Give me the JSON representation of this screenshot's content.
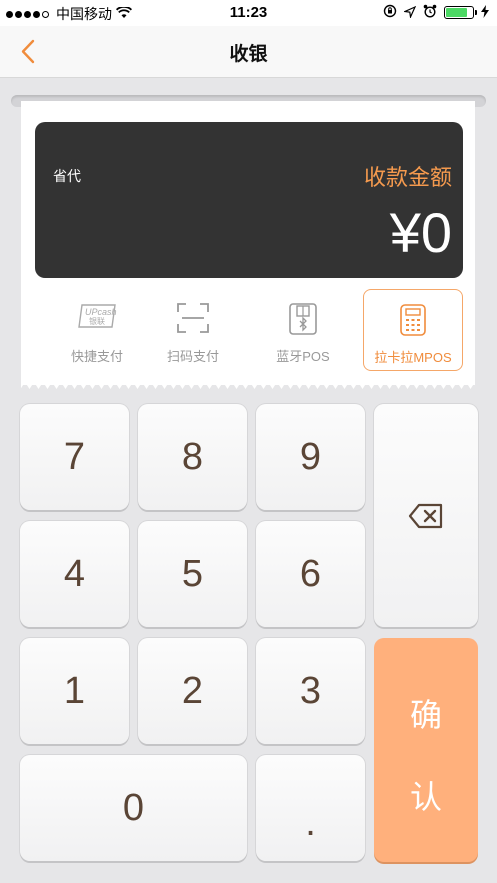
{
  "status_bar": {
    "carrier": "中国移动",
    "time": "11:23"
  },
  "nav": {
    "title": "收银",
    "back_icon": "chevron-left-icon",
    "accent_color": "#f08c3c"
  },
  "amount_card": {
    "province": "省代",
    "label": "收款金额",
    "amount": "¥0"
  },
  "pay_methods": [
    {
      "label": "快捷支付",
      "icon": "unionpay-card-icon",
      "active": false
    },
    {
      "label": "扫码支付",
      "icon": "scan-frame-icon",
      "active": false
    },
    {
      "label": "蓝牙POS",
      "icon": "bluetooth-pos-icon",
      "active": false
    },
    {
      "label": "拉卡拉MPOS",
      "icon": "mpos-calculator-icon",
      "active": true
    }
  ],
  "unionpay_icon_text": {
    "top": "UPcash",
    "bottom": "银联"
  },
  "keypad": {
    "k7": "7",
    "k8": "8",
    "k9": "9",
    "k4": "4",
    "k5": "5",
    "k6": "6",
    "k1": "1",
    "k2": "2",
    "k3": "3",
    "k0": "0",
    "dot": ".",
    "backspace_icon": "backspace-icon",
    "confirm_line1": "确",
    "confirm_line2": "认",
    "confirm_color": "#ffb07c"
  }
}
